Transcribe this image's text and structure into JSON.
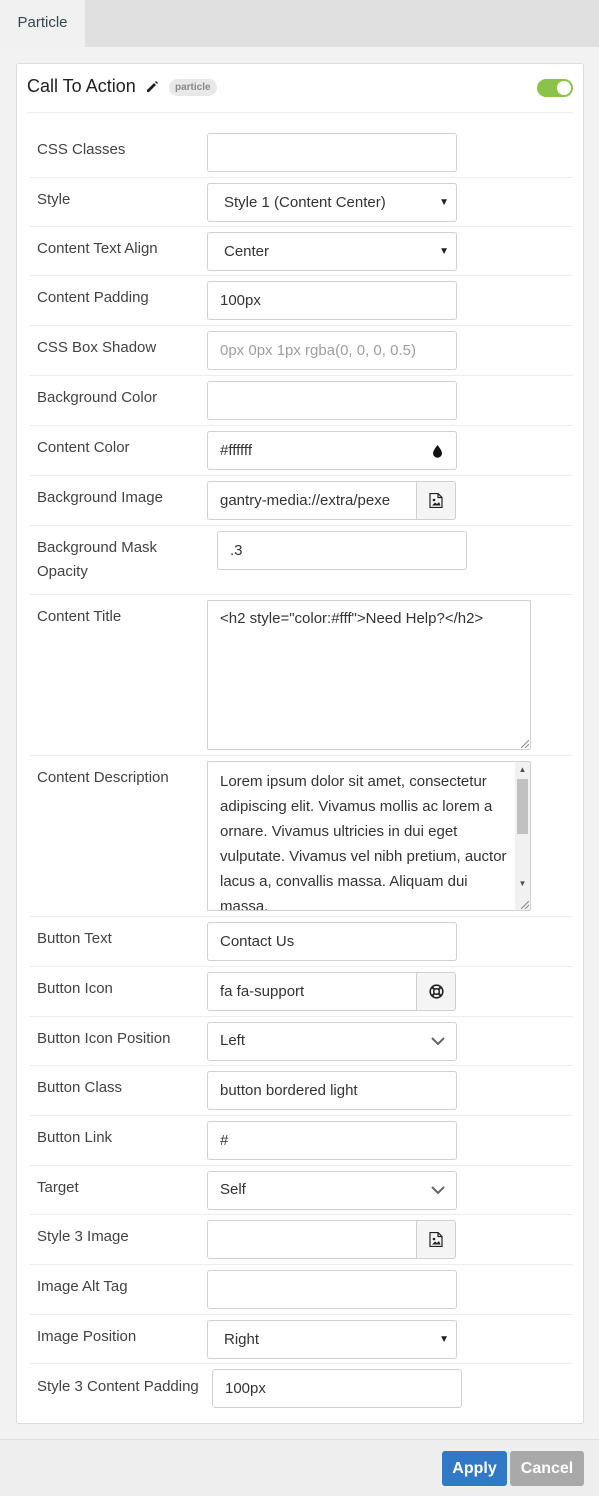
{
  "tab": {
    "label": "Particle"
  },
  "header": {
    "title": "Call To Action",
    "badge": "particle",
    "edit_icon": "pencil-icon",
    "toggle_on": true,
    "toggle_color": "#8bc34a"
  },
  "fields": {
    "css_classes": {
      "label": "CSS Classes",
      "value": ""
    },
    "style": {
      "label": "Style",
      "value": "Style 1 (Content Center)"
    },
    "content_text_align": {
      "label": "Content Text Align",
      "value": "Center"
    },
    "content_padding": {
      "label": "Content Padding",
      "value": "100px"
    },
    "css_box_shadow": {
      "label": "CSS Box Shadow",
      "value": "",
      "placeholder": "0px 0px 1px rgba(0, 0, 0, 0.5)"
    },
    "background_color": {
      "label": "Background Color",
      "value": ""
    },
    "content_color": {
      "label": "Content Color",
      "value": "#ffffff",
      "icon": "droplet-icon"
    },
    "background_image": {
      "label": "Background Image",
      "value": "gantry-media://extra/pexe",
      "icon": "image-icon"
    },
    "background_mask_opacity": {
      "label": "Background Mask Opacity",
      "value": ".3"
    },
    "content_title": {
      "label": "Content Title",
      "value": "<h2 style=\"color:#fff\">Need Help?</h2>"
    },
    "content_description": {
      "label": "Content Description",
      "value": "Lorem ipsum dolor sit amet, consectetur adipiscing elit. Vivamus mollis ac lorem a ornare. Vivamus ultricies in dui eget vulputate. Vivamus vel nibh pretium, auctor lacus a, convallis massa. Aliquam dui massa,"
    },
    "button_text": {
      "label": "Button Text",
      "value": "Contact Us"
    },
    "button_icon": {
      "label": "Button Icon",
      "value": "fa fa-support",
      "icon": "lifebuoy-icon"
    },
    "button_icon_position": {
      "label": "Button Icon Position",
      "value": "Left"
    },
    "button_class": {
      "label": "Button Class",
      "value": "button bordered light"
    },
    "button_link": {
      "label": "Button Link",
      "value": "#"
    },
    "target": {
      "label": "Target",
      "value": "Self"
    },
    "style3_image": {
      "label": "Style 3 Image",
      "value": "",
      "icon": "image-icon"
    },
    "image_alt_tag": {
      "label": "Image Alt Tag",
      "value": ""
    },
    "image_position": {
      "label": "Image Position",
      "value": "Right"
    },
    "style3_content_padding": {
      "label": "Style 3 Content Padding",
      "value": "100px"
    }
  },
  "footer": {
    "apply_label": "Apply",
    "cancel_label": "Cancel",
    "apply_color": "#3178c6",
    "cancel_color": "#a9a9a9"
  }
}
